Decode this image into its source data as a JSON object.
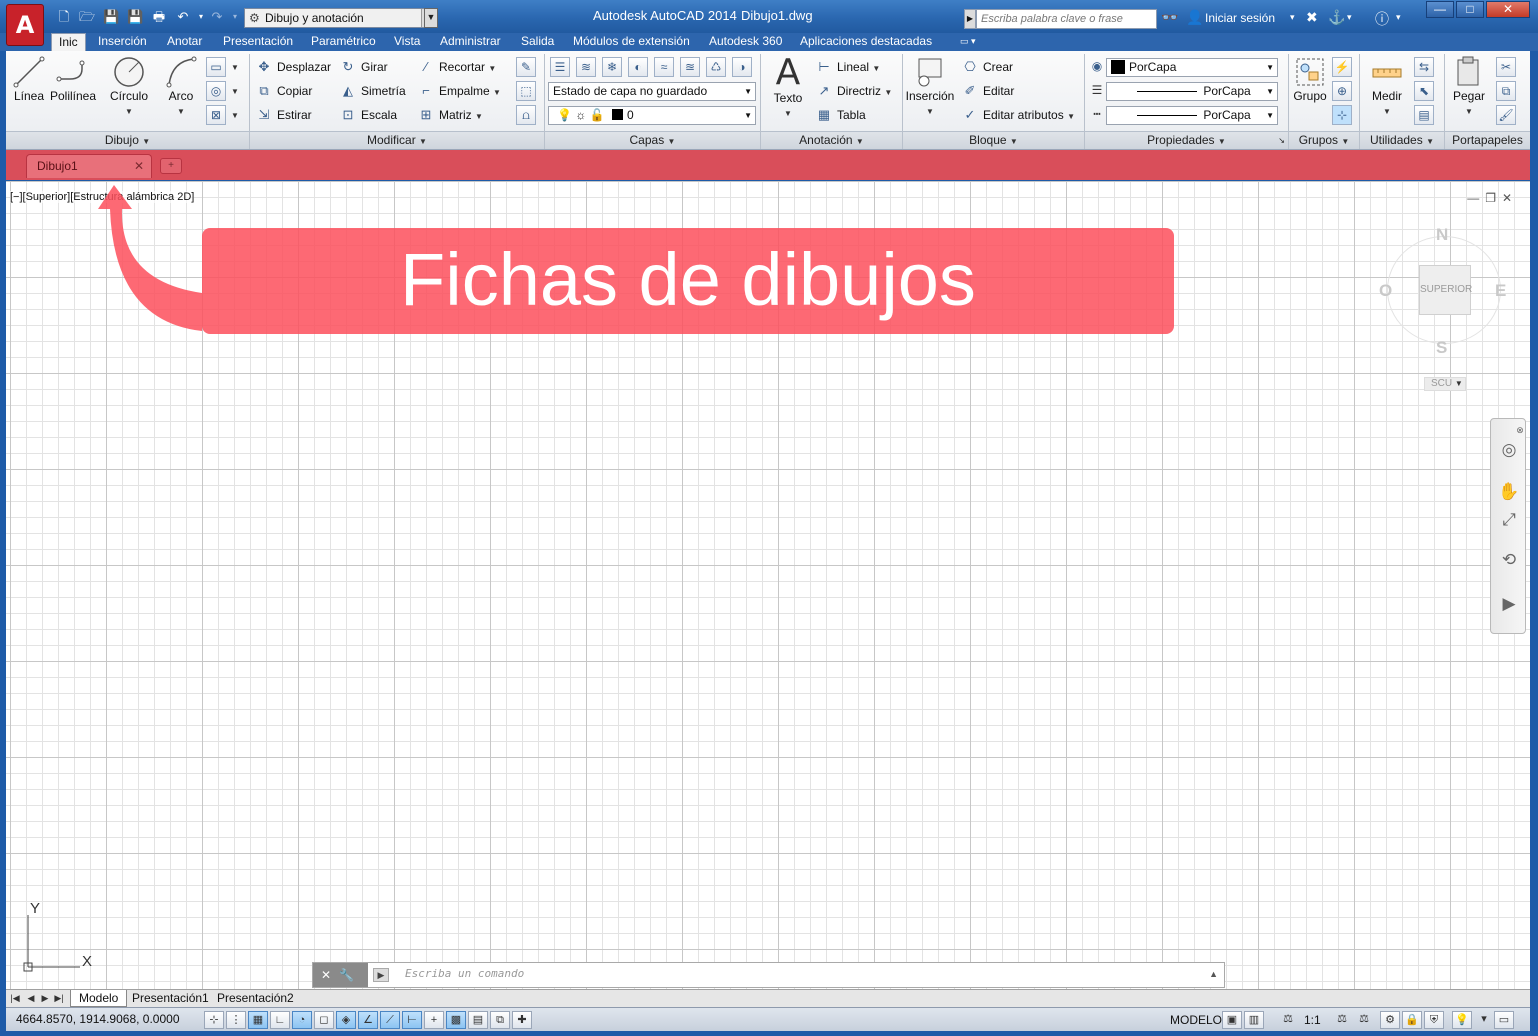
{
  "titlebar": {
    "logo": "A",
    "workspace": "Dibujo y anotación",
    "app_title": "Autodesk AutoCAD 2014",
    "doc_title": "Dibujo1.dwg",
    "search_placeholder": "Escriba palabra clave o frase",
    "signin": "Iniciar sesión"
  },
  "ribbon_tabs": [
    "Inic",
    "Inserción",
    "Anotar",
    "Presentación",
    "Paramétrico",
    "Vista",
    "Administrar",
    "Salida",
    "Módulos de extensión",
    "Autodesk 360",
    "Aplicaciones destacadas"
  ],
  "ribbon": {
    "dibujo": {
      "title": "Dibujo",
      "linea": "Línea",
      "polilinea": "Polilínea",
      "circulo": "Círculo",
      "arco": "Arco"
    },
    "modificar": {
      "title": "Modificar",
      "desplazar": "Desplazar",
      "girar": "Girar",
      "recortar": "Recortar",
      "copiar": "Copiar",
      "simetria": "Simetría",
      "empalme": "Empalme",
      "estirar": "Estirar",
      "escala": "Escala",
      "matriz": "Matriz"
    },
    "capas": {
      "title": "Capas",
      "estado": "Estado de capa no guardado",
      "layer_name": "0"
    },
    "anotacion": {
      "title": "Anotación",
      "texto": "Texto",
      "lineal": "Lineal",
      "directriz": "Directriz",
      "tabla": "Tabla"
    },
    "bloque": {
      "title": "Bloque",
      "insercion": "Inserción",
      "crear": "Crear",
      "editar": "Editar",
      "editar_atributos": "Editar atributos"
    },
    "propiedades": {
      "title": "Propiedades",
      "color": "PorCapa",
      "linetype": "PorCapa",
      "lineweight": "PorCapa"
    },
    "grupos": {
      "title": "Grupos",
      "grupo": "Grupo"
    },
    "utilidades": {
      "title": "Utilidades",
      "medir": "Medir"
    },
    "portapapeles": {
      "title": "Portapapeles",
      "pegar": "Pegar"
    }
  },
  "file_tab": {
    "label": "Dibujo1"
  },
  "viewport": {
    "label": "[−][Superior][Estructura alámbrica 2D]",
    "callout": "Fichas de dibujos"
  },
  "viewcube": {
    "north": "N",
    "south": "S",
    "east": "E",
    "west": "O",
    "face": "SUPERIOR",
    "ucs": "SCU"
  },
  "ucs_icon": {
    "x": "X",
    "y": "Y"
  },
  "command": {
    "placeholder": "Escriba un comando"
  },
  "layout_tabs": [
    "Modelo",
    "Presentación1",
    "Presentación2"
  ],
  "status": {
    "coords": "4664.8570, 1914.9068, 0.0000",
    "model": "MODELO",
    "scale": "1:1"
  },
  "colors": {
    "accent": "#d94e5a",
    "callout": "#fd4f5c",
    "titlebar": "#2a67b0"
  }
}
